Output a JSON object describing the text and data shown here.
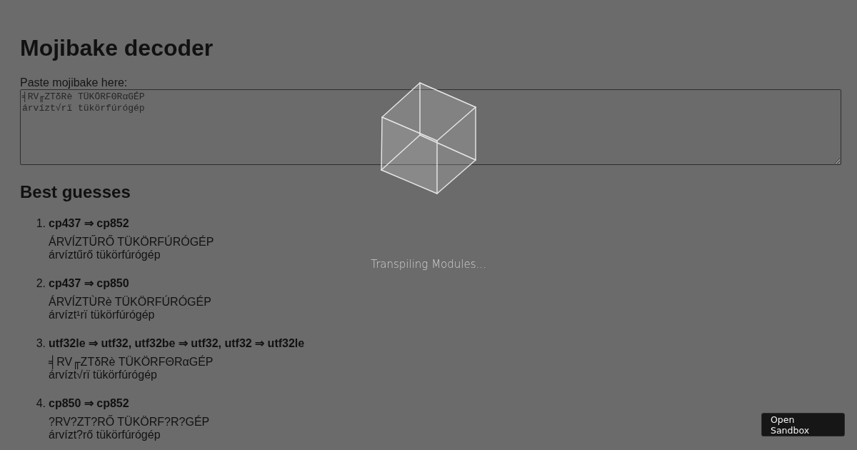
{
  "page": {
    "title": "Mojibake decoder"
  },
  "input": {
    "label": "Paste mojibake here:",
    "value": "╡RV╓ZTδRè TÜKÖRFΘRαGÉP\nárvízt√rï tükörfúrógép"
  },
  "results": {
    "heading": "Best guesses",
    "items": [
      {
        "number": "1.",
        "encodings": "cp437 ⇒ cp852",
        "lines": [
          "ÁRVÍZTŰRŐ TÜKÖRFÚRÓGÉP",
          "árvíztűrő tükörfúrógép"
        ]
      },
      {
        "number": "2.",
        "encodings": "cp437 ⇒ cp850",
        "lines": [
          "ÁRVÍZTÙRè TÜKÖRFÚRÓGÉP",
          "árvízt¹rï tükörfúrógép"
        ]
      },
      {
        "number": "3.",
        "encodings": "utf32le ⇒ utf32, utf32be ⇒ utf32, utf32 ⇒ utf32le",
        "lines": [
          "╡RV╓ZTδRè TÜKÖRFΘRαGÉP",
          "árvízt√rï tükörfúrógép"
        ]
      },
      {
        "number": "4.",
        "encodings": "cp850 ⇒ cp852",
        "lines": [
          "?RV?ZT?RŐ TÜKÖRF?R?GÉP",
          "árvízt?rő tükörfúrógép"
        ]
      }
    ]
  },
  "loading_overlay": {
    "message": "Transpiling Modules..."
  },
  "open_sandbox_button": {
    "label": "Open Sandbox"
  }
}
